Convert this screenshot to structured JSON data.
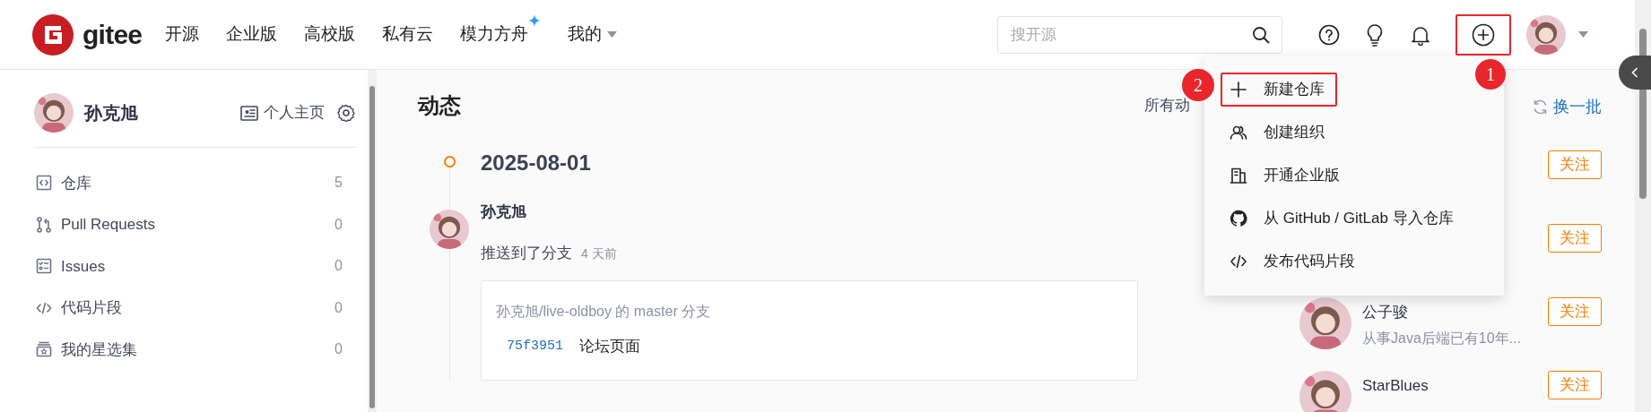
{
  "header": {
    "logo": "gitee",
    "nav": [
      {
        "label": "开源",
        "kind": "plain"
      },
      {
        "label": "企业版",
        "kind": "plain"
      },
      {
        "label": "高校版",
        "kind": "plain"
      },
      {
        "label": "私有云",
        "kind": "plain"
      },
      {
        "label": "模力方舟",
        "kind": "sparkle"
      },
      {
        "label": "我的",
        "kind": "dropdown"
      }
    ],
    "search": {
      "placeholder": "搜开源"
    },
    "create_button": {
      "highlighted": true,
      "step": "1"
    }
  },
  "sidebar": {
    "user": "孙克旭",
    "profile_link": "个人主页",
    "items": [
      {
        "label": "仓库",
        "count": "5",
        "kind": "repo"
      },
      {
        "label": "Pull Requests",
        "count": "0",
        "kind": "pr"
      },
      {
        "label": "Issues",
        "count": "0",
        "kind": "issue"
      },
      {
        "label": "代码片段",
        "count": "0",
        "kind": "code"
      },
      {
        "label": "我的星选集",
        "count": "0",
        "kind": "star"
      }
    ]
  },
  "feed": {
    "title": "动态",
    "filter": "所有动",
    "date": "2025-08-01",
    "author": "孙克旭",
    "action": "推送到了分支",
    "time": "4 天前",
    "card": {
      "branch": "孙克旭/live-oldboy 的 master 分支",
      "commit_hash": "75f3951",
      "commit_message": "论坛页面"
    }
  },
  "create_menu": {
    "items": [
      {
        "label": "新建仓库",
        "kind": "plus",
        "highlighted": true,
        "step": "2"
      },
      {
        "label": "创建组织",
        "kind": "org",
        "highlighted": false
      },
      {
        "label": "开通企业版",
        "kind": "building",
        "highlighted": false
      },
      {
        "label": "从 GitHub / GitLab 导入仓库",
        "kind": "github",
        "highlighted": false
      },
      {
        "label": "发布代码片段",
        "kind": "code",
        "highlighted": false
      }
    ]
  },
  "recommend": {
    "refresh": "换一批",
    "users": [
      {
        "follow": "关注"
      },
      {
        "follow": "关注"
      },
      {
        "name": "公子骏",
        "bio": "从事Java后端已有10年...",
        "follow": "关注"
      },
      {
        "name": "StarBlues",
        "follow": "关注"
      }
    ]
  }
}
